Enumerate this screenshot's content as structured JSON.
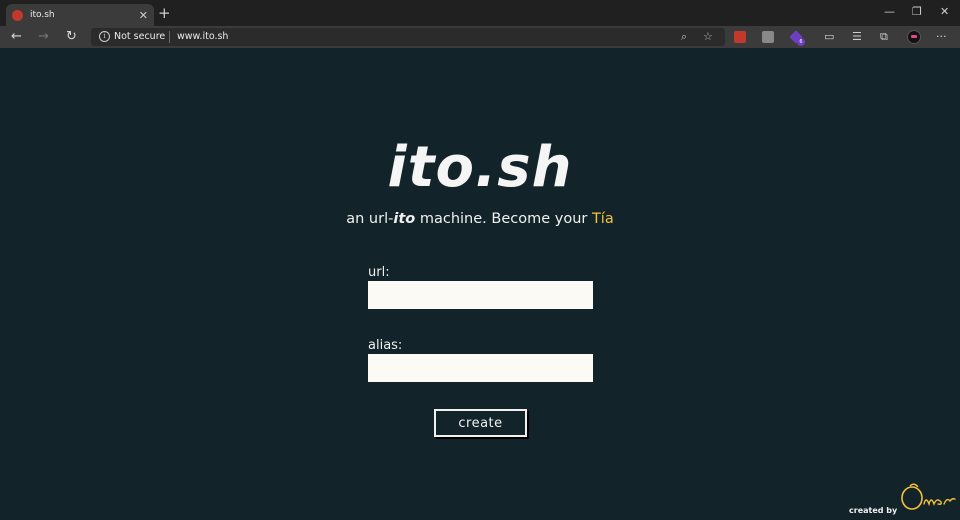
{
  "browser": {
    "tab_title": "ito.sh",
    "tab_close": "✕",
    "new_tab": "+",
    "security_label": "Not secure",
    "address": "www.ito.sh",
    "window_controls": {
      "minimize": "—",
      "restore": "❐",
      "close": "✕"
    },
    "icons": {
      "back": "←",
      "forward": "→",
      "reload": "↻",
      "zoom": "⌕",
      "favorite": "☆",
      "cast": "▭",
      "favorites_list": "☰",
      "collections": "⧉",
      "menu": "···"
    },
    "extension_badge": "6",
    "colors": {
      "ext_red": "#c0392b",
      "ext_gray": "#888888",
      "ext_purple": "#6b3fc0"
    }
  },
  "page": {
    "logo": "ito.sh",
    "tagline": {
      "prefix": "an url-",
      "ito": "ito",
      "middle": " machine. Become your ",
      "tia": "Tía"
    },
    "form": {
      "url_label": "url:",
      "url_value": "",
      "alias_label": "alias:",
      "alias_value": "",
      "create_label": "create"
    },
    "credit": "created by",
    "signature_name": "Omar",
    "colors": {
      "background": "#12232a",
      "accent": "#f4c23a",
      "input_bg": "#fcfaf4",
      "text": "#f0f0f0"
    }
  }
}
